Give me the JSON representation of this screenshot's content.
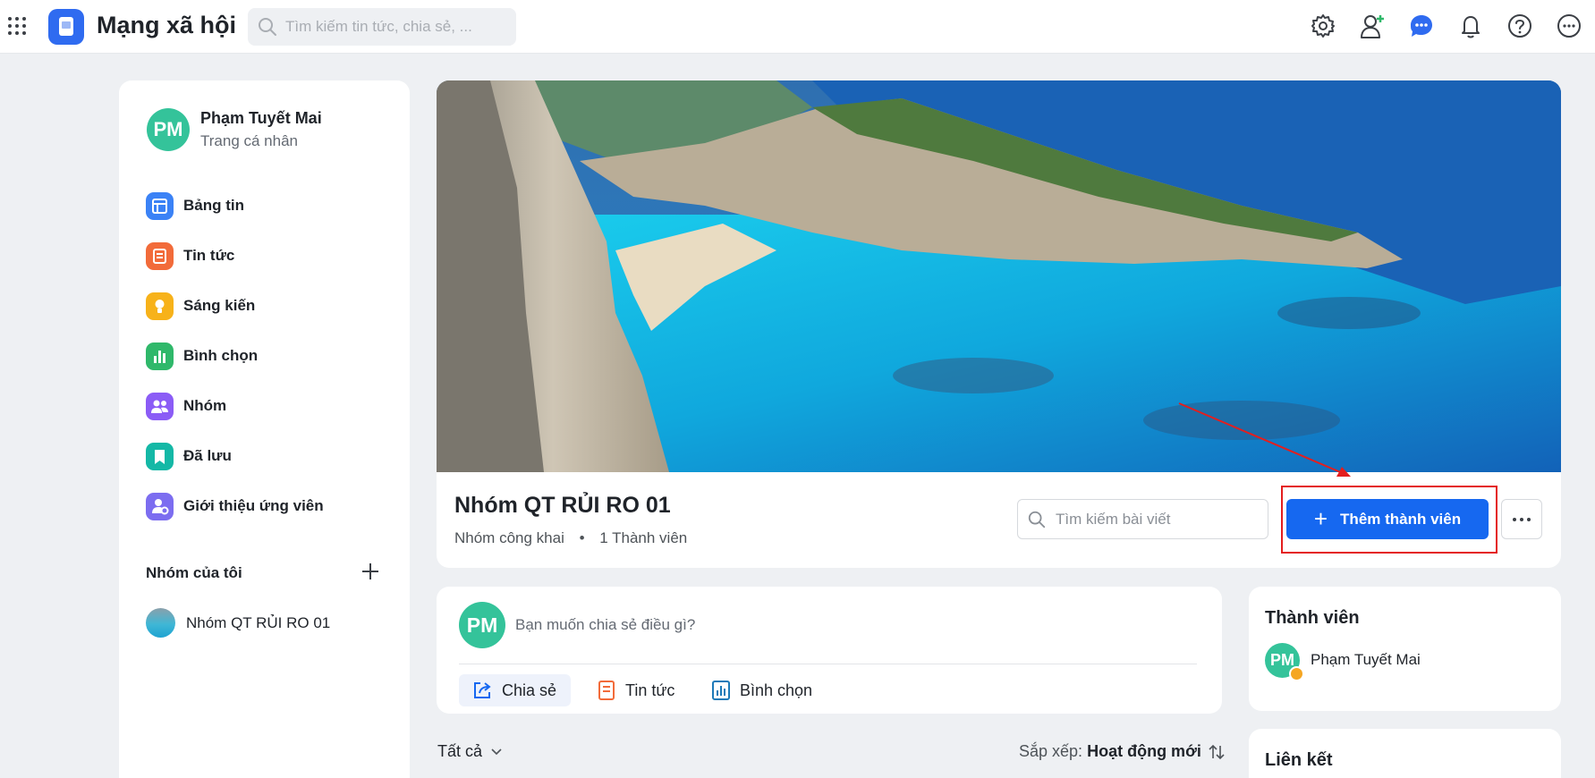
{
  "app": {
    "title": "Mạng xã hội",
    "search_placeholder": "Tìm kiếm tin tức, chia sẻ, ..."
  },
  "top_icons": [
    "gear-icon",
    "add-user-icon",
    "chat-icon",
    "bell-icon",
    "help-icon",
    "more-icon"
  ],
  "profile": {
    "name": "Phạm Tuyết Mai",
    "subtitle": "Trang cá nhân",
    "initials": "PM"
  },
  "nav": {
    "items": [
      {
        "label": "Bảng tin",
        "icon": "dashboard-icon",
        "color": "#3b82f6"
      },
      {
        "label": "Tin tức",
        "icon": "news-icon",
        "color": "#f26b3a"
      },
      {
        "label": "Sáng kiến",
        "icon": "lightbulb-icon",
        "color": "#f7b21a"
      },
      {
        "label": "Bình chọn",
        "icon": "poll-icon",
        "color": "#2fb86a"
      },
      {
        "label": "Nhóm",
        "icon": "group-icon",
        "color": "#8b5cf6"
      },
      {
        "label": "Đã lưu",
        "icon": "bookmark-icon",
        "color": "#14b8a6"
      },
      {
        "label": "Giới thiệu ứng viên",
        "icon": "referral-icon",
        "color": "#7c6df0"
      }
    ]
  },
  "my_groups": {
    "title": "Nhóm của tôi",
    "items": [
      {
        "label": "Nhóm QT RỦI RO 01"
      }
    ]
  },
  "group": {
    "title": "Nhóm QT RỦI RO 01",
    "visibility": "Nhóm công khai",
    "separator": "•",
    "member_count": "1 Thành viên",
    "search_placeholder": "Tìm kiếm bài viết",
    "add_member_label": "Thêm thành viên"
  },
  "composer": {
    "initials": "PM",
    "prompt": "Bạn muốn chia sẻ điều gì?",
    "actions": [
      {
        "label": "Chia sẻ",
        "icon": "share-icon"
      },
      {
        "label": "Tin tức",
        "icon": "news-icon"
      },
      {
        "label": "Bình chọn",
        "icon": "poll-icon"
      }
    ]
  },
  "feed": {
    "filter_label": "Tất cả",
    "sort_prefix": "Sắp xếp:",
    "sort_value": "Hoạt động mới"
  },
  "members": {
    "title": "Thành viên",
    "items": [
      {
        "name": "Phạm Tuyết Mai",
        "initials": "PM"
      }
    ]
  },
  "links": {
    "title": "Liên kết"
  },
  "colors": {
    "primary": "#1668f0",
    "avatar": "#34c39a",
    "annotation": "#e41e1e"
  }
}
